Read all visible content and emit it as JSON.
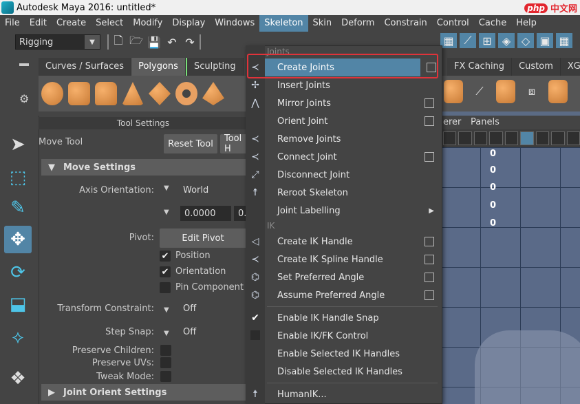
{
  "window": {
    "title": "Autodesk Maya 2016: untitled*",
    "watermark_brand": "php",
    "watermark_text": "中文网"
  },
  "menubar": [
    "File",
    "Edit",
    "Create",
    "Select",
    "Modify",
    "Display",
    "Windows",
    "Skeleton",
    "Skin",
    "Deform",
    "Constrain",
    "Control",
    "Cache",
    "Help"
  ],
  "active_menu": "Skeleton",
  "statusline": {
    "mode": "Rigging"
  },
  "shelf": {
    "tabs": [
      "Curves / Surfaces",
      "Polygons",
      "Sculpting",
      "FX Caching",
      "Custom",
      "XG"
    ],
    "active_tab": "Polygons"
  },
  "tool_settings": {
    "header": "Tool Settings",
    "tool_name": "Move Tool",
    "reset_button": "Reset Tool",
    "tool_help_button": "Tool H",
    "move_settings": "Move Settings",
    "axis_orientation_label": "Axis Orientation:",
    "axis_orientation_value": "World",
    "num_field_1": "0.0000",
    "num_field_2": "0.",
    "pivot_label": "Pivot:",
    "edit_pivot_button": "Edit Pivot",
    "position_label": "Position",
    "orientation_label": "Orientation",
    "pin_component_label": "Pin Component Pi",
    "transform_constraint_label": "Transform Constraint:",
    "transform_constraint_value": "Off",
    "step_snap_label": "Step Snap:",
    "step_snap_value": "Off",
    "preserve_children_label": "Preserve Children:",
    "preserve_uvs_label": "Preserve UVs:",
    "tweak_mode_label": "Tweak Mode:",
    "joint_orient_settings": "Joint Orient Settings"
  },
  "viewport": {
    "panel_menu_1": "erer",
    "panel_menu_2": "Panels",
    "hud_values": [
      "0",
      "0",
      "0",
      "0",
      "0"
    ]
  },
  "skeleton_menu": {
    "section_joints": "Joints",
    "section_ik": "IK",
    "items": [
      {
        "label": "Create Joints",
        "option_box": true,
        "highlighted": true
      },
      {
        "label": "Insert Joints",
        "option_box": false
      },
      {
        "label": "Mirror Joints",
        "option_box": true
      },
      {
        "label": "Orient Joint",
        "option_box": true
      },
      {
        "label": "Remove Joints",
        "option_box": false
      },
      {
        "label": "Connect Joint",
        "option_box": true
      },
      {
        "label": "Disconnect Joint",
        "option_box": false
      },
      {
        "label": "Reroot Skeleton",
        "option_box": false
      },
      {
        "label": "Joint Labelling",
        "submenu": true
      }
    ],
    "ik_items": [
      {
        "label": "Create IK Handle",
        "option_box": true
      },
      {
        "label": "Create IK Spline Handle",
        "option_box": true
      },
      {
        "label": "Set Preferred Angle",
        "option_box": true
      },
      {
        "label": "Assume Preferred Angle",
        "option_box": true
      }
    ],
    "toggle_items": [
      {
        "label": "Enable IK Handle Snap",
        "checked": true
      },
      {
        "label": "Enable IK/FK Control",
        "checked": false
      },
      {
        "label": "Enable Selected IK Handles"
      },
      {
        "label": "Disable Selected IK Handles"
      }
    ],
    "humanik": "HumanIK..."
  },
  "colors": {
    "accent": "#5285a6",
    "highlight_border": "#e0333a",
    "poly_icon": "#e8a062"
  }
}
